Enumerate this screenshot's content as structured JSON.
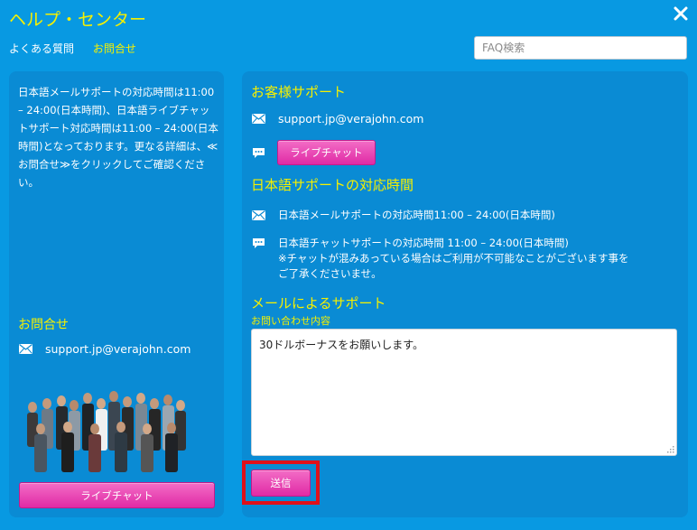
{
  "window": {
    "title": "ヘルプ・センター"
  },
  "nav": {
    "faq": "よくある質問",
    "contact": "お問合せ"
  },
  "search": {
    "placeholder": "FAQ検索"
  },
  "left": {
    "info": "日本語メールサポートの対応時間は11:00 – 24:00(日本時間)、日本語ライブチャットサポート対応時間は11:00 – 24:00(日本時間)となっております。更なる詳細は、≪お問合せ≫をクリックしてご確認ください。",
    "contact_title": "お問合せ",
    "email": "support.jp@verajohn.com",
    "chat_button": "ライブチャット"
  },
  "right": {
    "customer_support_title": "お客様サポート",
    "email": "support.jp@verajohn.com",
    "chat_button": "ライブチャット",
    "hours_title": "日本語サポートの対応時間",
    "mail_hours": "日本語メールサポートの対応時間11:00 – 24:00(日本時間)",
    "chat_hours_line1": "日本語チャットサポートの対応時間 11:00 – 24:00(日本時間)",
    "chat_hours_line2": "※チャットが混みあっている場合はご利用が不可能なことがございます事を",
    "chat_hours_line3": "ご了承くださいませ。",
    "mail_support_title": "メールによるサポート",
    "inquiry_label": "お問い合わせ内容",
    "inquiry_text": "30ドルボーナスをお願いします。",
    "send_button": "送信"
  },
  "colors": {
    "background": "#0899e2",
    "panel": "#0a8bd4",
    "accent": "#f6f000",
    "button": "#e02aa5",
    "highlight": "#e0101a"
  },
  "icons": {
    "close": "close-icon",
    "mail": "mail-icon",
    "chat": "chat-bubble-icon"
  }
}
